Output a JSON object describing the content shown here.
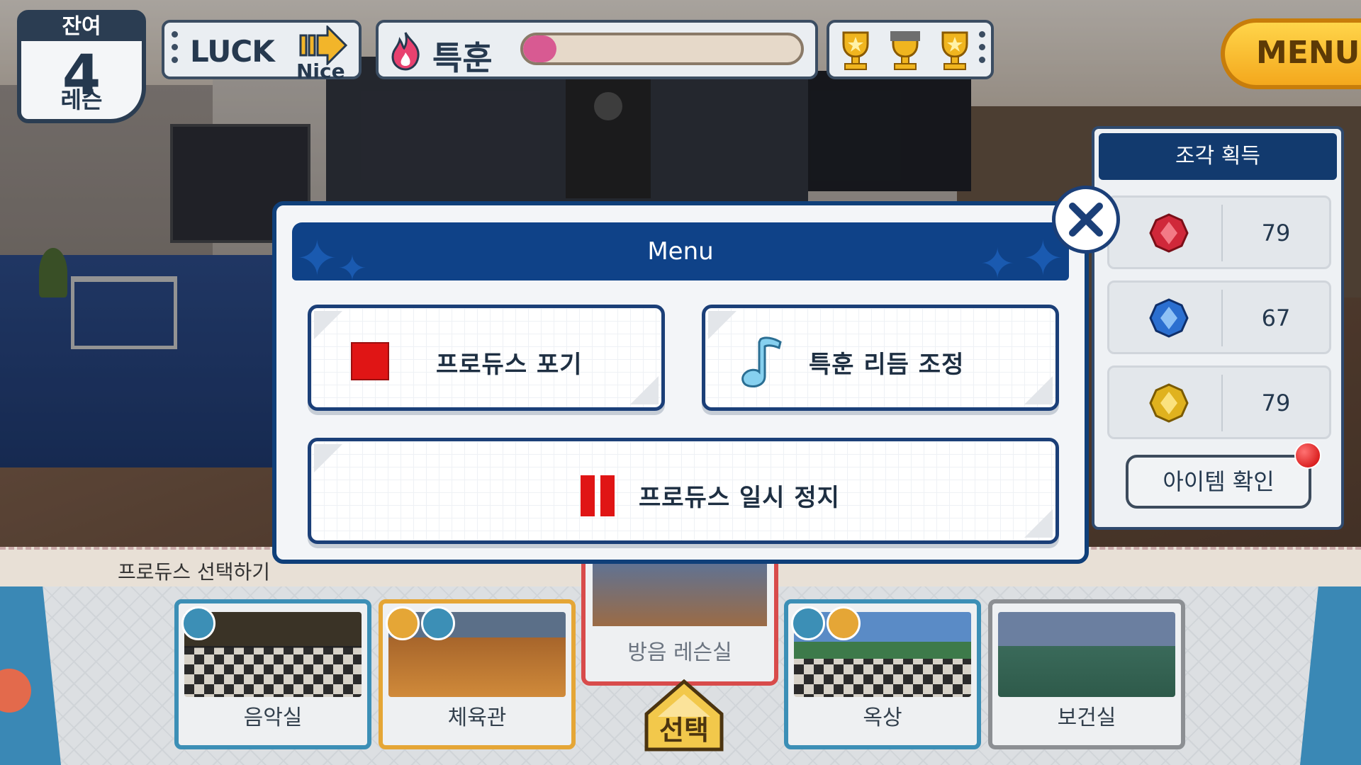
{
  "hud": {
    "remaining_top": "잔여",
    "remaining_number": "4",
    "remaining_unit": "레슨",
    "luck_label": "LUCK",
    "luck_value": "Nice",
    "training_label": "특훈",
    "training_progress": 0.12,
    "menu_label": "MENU"
  },
  "side_panel": {
    "title": "조각 획득",
    "rows": [
      {
        "gem": "red-gem-icon",
        "value": "79",
        "color": "#d0283a"
      },
      {
        "gem": "blue-gem-icon",
        "value": "67",
        "color": "#2b6fd0"
      },
      {
        "gem": "yellow-gem-icon",
        "value": "79",
        "color": "#e0b21e"
      }
    ],
    "item_button": "아이템 확인"
  },
  "bottom": {
    "select_produce_label": "프로듀스 선택하기",
    "rooms": [
      {
        "name": "음악실"
      },
      {
        "name": "체육관"
      },
      {
        "name": "방음 레슨실"
      },
      {
        "name": "옥상"
      },
      {
        "name": "보건실"
      }
    ],
    "select_button": "선택"
  },
  "modal": {
    "title": "Menu",
    "buttons": {
      "quit": "프로듀스 포기",
      "rhythm": "특훈 리듬 조정",
      "pause": "프로듀스 일시 정지"
    }
  },
  "colors": {
    "modal_header": "#0f4288",
    "modal_border": "#1b3f78",
    "accent_red": "#e01515",
    "menu_orange": "#f4a81d"
  }
}
